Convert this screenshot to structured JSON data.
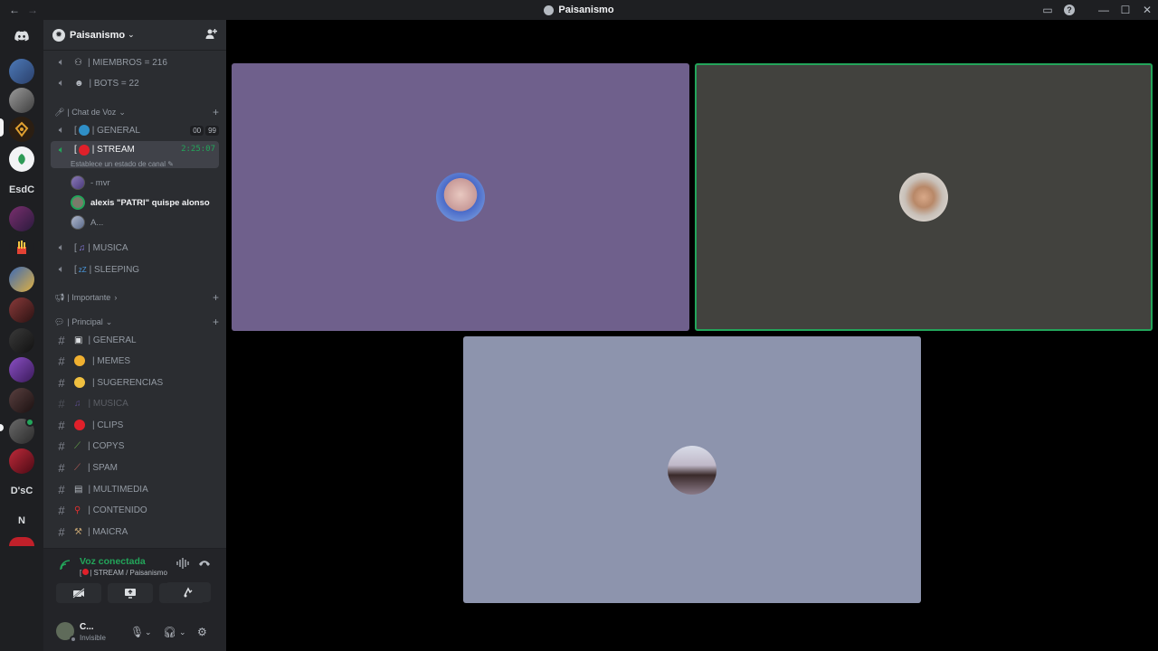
{
  "titlebar": {
    "back_icon": "←",
    "forward_icon": "→",
    "title": "Paisanismo",
    "inbox_icon": "▭",
    "help_icon": "?",
    "minimize": "—",
    "maximize": "☐",
    "close": "✕"
  },
  "rail": {
    "home_icon": "discord-icon",
    "text_servers": [
      "EsdC",
      "D'sC",
      "N"
    ]
  },
  "server": {
    "name": "Paisanismo",
    "chevron": "⌄",
    "invite_icon": "♟"
  },
  "channels": {
    "members": "| MIEMBROS = 216",
    "bots": "| BOTS = 22",
    "cat_voice": "| Chat de Voz",
    "general_voice": "| GENERAL",
    "general_counter": [
      "00",
      "99"
    ],
    "stream": "| STREAM",
    "stream_timer": "2:25:07",
    "stream_status": "Establece un estado de canal",
    "voice_users": [
      "- mvr",
      "alexis \"PATRI\" quispe alonso",
      "A..."
    ],
    "musica": "| MUSICA",
    "sleeping": "| SLEEPING",
    "cat_importante": "| Importante",
    "cat_principal": "| Principal",
    "text_channels": [
      "| GENERAL",
      "| MEMES",
      "| SUGERENCIAS",
      "| MUSICA",
      "| CLIPS",
      "| COPYS",
      "| SPAM",
      "| MULTIMEDIA",
      "| CONTENIDO",
      "| MAICRA"
    ]
  },
  "voice_panel": {
    "connected": "Voz conectada",
    "location": "| STREAM / Paisanismo"
  },
  "user": {
    "name": "C...",
    "status": "Invisible"
  },
  "colors": {
    "tile1": "#6f608c",
    "tile2": "#42423e",
    "tile3": "#8d94ad",
    "speaking": "#23a55a"
  }
}
